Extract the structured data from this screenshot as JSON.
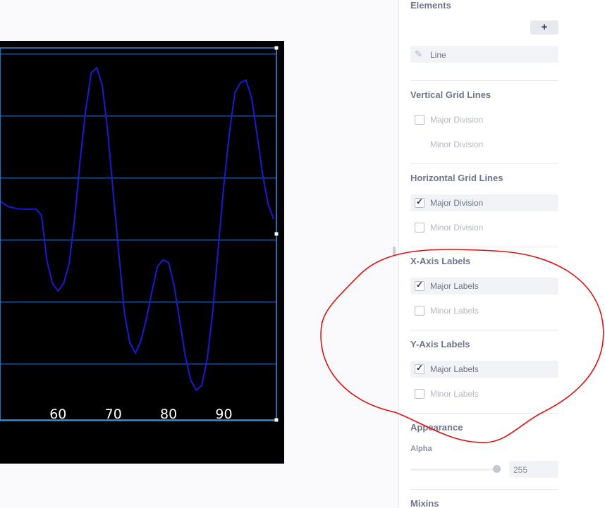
{
  "chart": {
    "x_ticks": [
      "60",
      "70",
      "80",
      "90"
    ],
    "line_color": "#1a1ad6",
    "grid_color": "#3f7fd6",
    "background": "#000000",
    "selection_color": "#3a8fd8"
  },
  "chart_data": {
    "type": "line",
    "x": [
      49,
      50,
      51,
      52,
      53,
      54,
      55,
      56,
      57,
      58,
      59,
      60,
      61,
      62,
      63,
      64,
      65,
      66,
      67,
      68,
      69,
      70,
      71,
      72,
      73,
      74,
      75,
      76,
      77,
      78,
      79,
      80,
      81,
      82,
      83,
      84,
      85,
      86,
      87,
      88,
      89,
      90,
      91,
      92,
      93,
      94,
      95,
      96,
      97,
      98,
      99
    ],
    "values": [
      0.08,
      0.05,
      0.02,
      0.01,
      0.0,
      0.0,
      0.0,
      0.0,
      -0.05,
      -0.42,
      -0.6,
      -0.66,
      -0.6,
      -0.44,
      -0.08,
      0.4,
      0.8,
      1.1,
      1.14,
      1.0,
      0.62,
      0.12,
      -0.36,
      -0.84,
      -1.08,
      -1.16,
      -1.06,
      -0.88,
      -0.66,
      -0.46,
      -0.41,
      -0.43,
      -0.62,
      -0.9,
      -1.18,
      -1.38,
      -1.46,
      -1.42,
      -1.2,
      -0.82,
      -0.3,
      0.2,
      0.62,
      0.94,
      1.02,
      1.04,
      0.9,
      0.6,
      0.28,
      0.04,
      -0.08
    ],
    "y_gridlines": [
      1.25,
      0.75,
      0.25,
      -0.25,
      -0.75,
      -1.25
    ],
    "xlim": [
      49.5,
      99.5
    ],
    "ylim": [
      -1.7,
      1.3
    ],
    "grid": "horizontal",
    "x_tick_values": [
      60,
      70,
      80,
      90
    ]
  },
  "panel": {
    "elements_title": "Elements",
    "add_label": "+",
    "line_element_label": "Line",
    "pencil_icon": "✎",
    "vertical_grid": {
      "title": "Vertical Grid Lines",
      "major_label": "Major Division",
      "minor_label": "Minor Division"
    },
    "horizontal_grid": {
      "title": "Horizontal Grid Lines",
      "major_label": "Major Division",
      "minor_label": "Minor Division"
    },
    "x_axis_labels": {
      "title": "X-Axis Labels",
      "major_label": "Major Labels",
      "minor_label": "Minor Labels"
    },
    "y_axis_labels": {
      "title": "Y-Axis Labels",
      "major_label": "Major Labels",
      "minor_label": "Minor Labels"
    },
    "appearance": {
      "title": "Appearance",
      "alpha_label": "Alpha",
      "alpha_value": "255",
      "alpha_fraction": 1.0
    },
    "mixins_title": "Mixins",
    "check_glyph": "✓"
  },
  "annotation_color": "#e01010"
}
